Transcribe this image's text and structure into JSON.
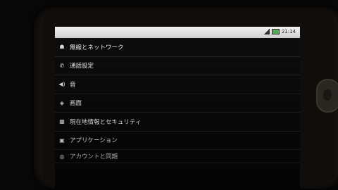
{
  "status_bar": {
    "title": "",
    "time": "21:14"
  },
  "settings_list": [
    {
      "icon": "wireless-icon",
      "glyph": "☗",
      "label": "無線とネットワーク"
    },
    {
      "icon": "phone-icon",
      "glyph": "✆",
      "label": "通話設定"
    },
    {
      "icon": "speaker-icon",
      "glyph": "◀)",
      "label": "音"
    },
    {
      "icon": "display-icon",
      "glyph": "◈",
      "label": "画面"
    },
    {
      "icon": "location-security-icon",
      "glyph": "▦",
      "label": "現在地情報とセキュリティ"
    },
    {
      "icon": "applications-icon",
      "glyph": "▣",
      "label": "アプリケーション"
    },
    {
      "icon": "account-sync-icon",
      "glyph": "◍",
      "label": "アカウントと同期"
    }
  ]
}
